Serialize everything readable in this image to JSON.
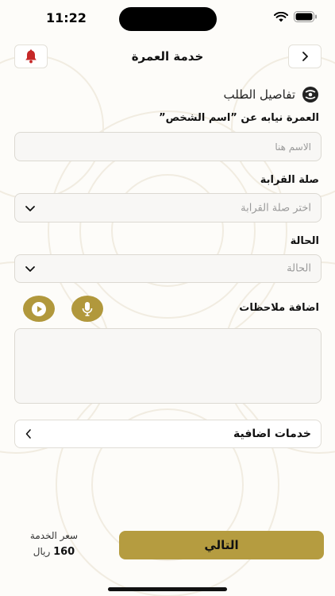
{
  "status_bar": {
    "time": "11:22"
  },
  "header": {
    "title": "خدمة  العمرة"
  },
  "section": {
    "title": "تفاصيل الطلب"
  },
  "form": {
    "name_label": "العمرة  نيابه عن ”اسم الشخص”",
    "name_placeholder": "الاسم هنا",
    "relation_label": "صلة القرابة",
    "relation_placeholder": "اختر صلة القرابة",
    "status_label": "الحالة",
    "status_placeholder": "الحالة",
    "notes_label": "اضافة ملاحظات"
  },
  "extras": {
    "label": "خدمات اضافية"
  },
  "footer": {
    "price_label": "سعر الخدمة",
    "price_amount": "160",
    "price_currency": "ريال",
    "next_label": "التالي"
  },
  "colors": {
    "accent": "#b59c40",
    "bell": "#c62828",
    "field_bg": "#f8f7f5"
  }
}
